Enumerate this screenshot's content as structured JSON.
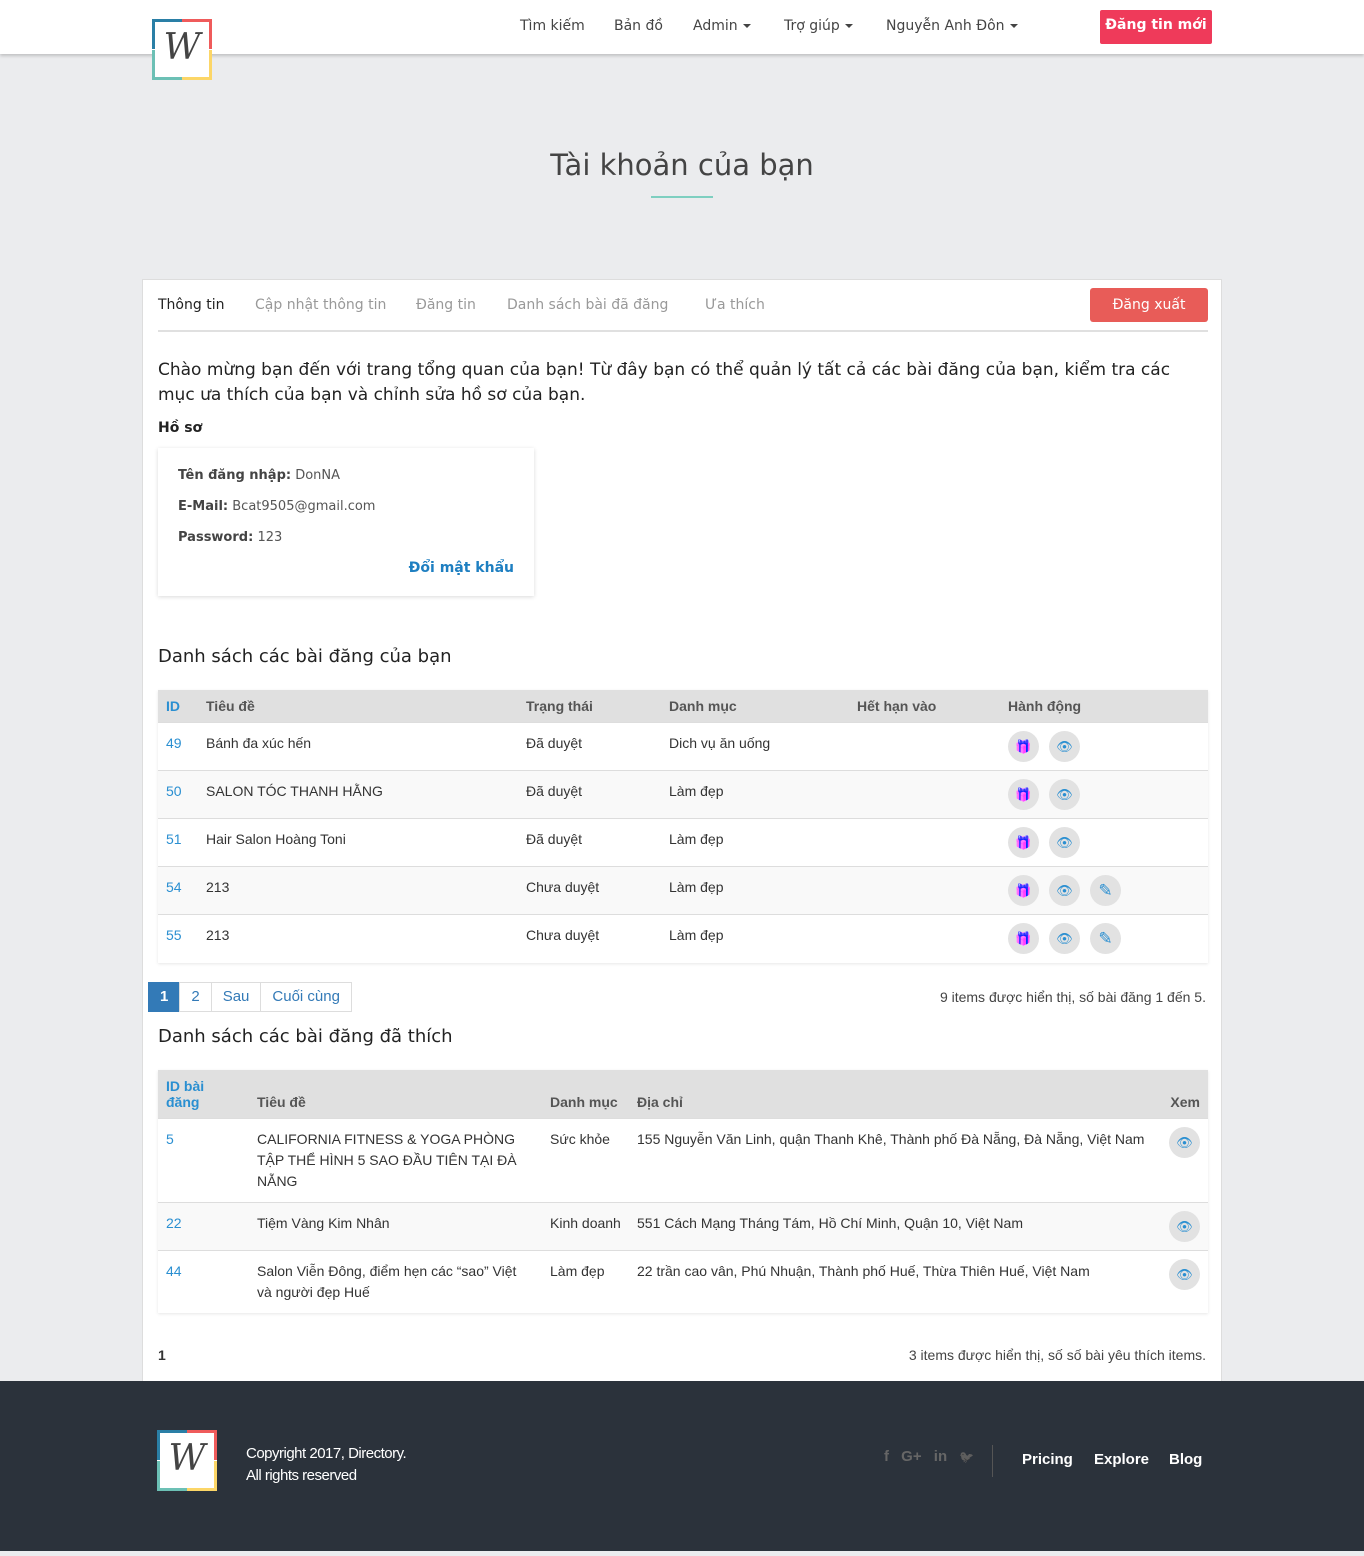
{
  "header": {
    "logo_text": "W",
    "nav": [
      "Tìm kiếm",
      "Bản đồ",
      "Admin",
      "Trợ giúp",
      "Nguyễn Anh Đôn"
    ],
    "new_post": "Đăng tin mới"
  },
  "page_title": "Tài khoản của bạn",
  "tabs": [
    "Thông tin",
    "Cập nhật thông tin",
    "Đăng tin",
    "Danh sách bài đã đăng",
    "Ưa thích"
  ],
  "logout": "Đăng xuất",
  "intro": "Chào mừng bạn đến với trang tổng quan của bạn! Từ đây bạn có thể quản lý tất cả các bài đăng của bạn, kiểm tra các mục ưa thích của bạn và chỉnh sửa hồ sơ của bạn.",
  "profile": {
    "heading": "Hồ sơ",
    "username_label": "Tên đăng nhập:",
    "username": "DonNA",
    "email_label": "E-Mail:",
    "email": "Bcat9505@gmail.com",
    "password_label": "Password:",
    "password": "123",
    "change_pw": "Đổi mật khẩu"
  },
  "posts": {
    "title": "Danh sách các bài đăng của bạn",
    "headers": [
      "ID",
      "Tiêu đề",
      "Trạng thái",
      "Danh mục",
      "Hết hạn vào",
      "Hành động"
    ],
    "rows": [
      {
        "id": "49",
        "title": "Bánh đa xúc hến",
        "status": "Đã duyệt",
        "category": "Dich vụ ăn uống",
        "expires": "",
        "edit": false
      },
      {
        "id": "50",
        "title": "SALON TÓC THANH HẰNG",
        "status": "Đã duyệt",
        "category": "Làm đẹp",
        "expires": "",
        "edit": false
      },
      {
        "id": "51",
        "title": "Hair Salon Hoàng Toni",
        "status": "Đã duyệt",
        "category": "Làm đẹp",
        "expires": "",
        "edit": false
      },
      {
        "id": "54",
        "title": "213",
        "status": "Chưa duyệt",
        "category": "Làm đẹp",
        "expires": "",
        "edit": true
      },
      {
        "id": "55",
        "title": "213",
        "status": "Chưa duyệt",
        "category": "Làm đẹp",
        "expires": "",
        "edit": true
      }
    ],
    "pagination": [
      "1",
      "2",
      "Sau",
      "Cuối cùng"
    ],
    "info": "9 items được hiển thị, số bài đăng 1 đến 5."
  },
  "favorites": {
    "title": "Danh sách các bài đăng đã thích",
    "headers": [
      "ID bài đăng",
      "Tiêu đề",
      "Danh mục",
      "Địa chỉ",
      "Xem"
    ],
    "rows": [
      {
        "id": "5",
        "title": "CALIFORNIA FITNESS & YOGA PHÒNG TẬP THỂ HÌNH 5 SAO ĐẦU TIÊN TẠI ĐÀ NẴNG",
        "category": "Sức khỏe",
        "address": "155 Nguyễn Văn Linh, quận Thanh Khê, Thành phố Đà Nẵng, Đà Nẵng, Việt Nam"
      },
      {
        "id": "22",
        "title": "Tiệm Vàng Kim Nhân",
        "category": "Kinh doanh",
        "address": "551 Cách Mạng Tháng Tám, Hồ Chí Minh, Quận 10, Việt Nam"
      },
      {
        "id": "44",
        "title": "Salon Viễn Đông, điểm hẹn các “sao” Việt và người đẹp Huế",
        "category": "Làm đẹp",
        "address": "22 trần cao vân, Phú Nhuận, Thành phố Huế, Thừa Thiên Huế, Việt Nam"
      }
    ],
    "page": "1",
    "info": "3 items được hiển thị, số số bài yêu thích items."
  },
  "footer": {
    "copyright": "Copyright 2017, Directory.",
    "rights": "All rights reserved",
    "social": [
      "f",
      "G+",
      "in",
      "🐦"
    ],
    "links": [
      "Pricing",
      "Explore",
      "Blog"
    ]
  },
  "colors": {
    "accent": "#ef3a5a",
    "logout": "#e85c58",
    "link": "#2a8fd1",
    "gift": "#22c22e",
    "footer": "#2b323b"
  }
}
